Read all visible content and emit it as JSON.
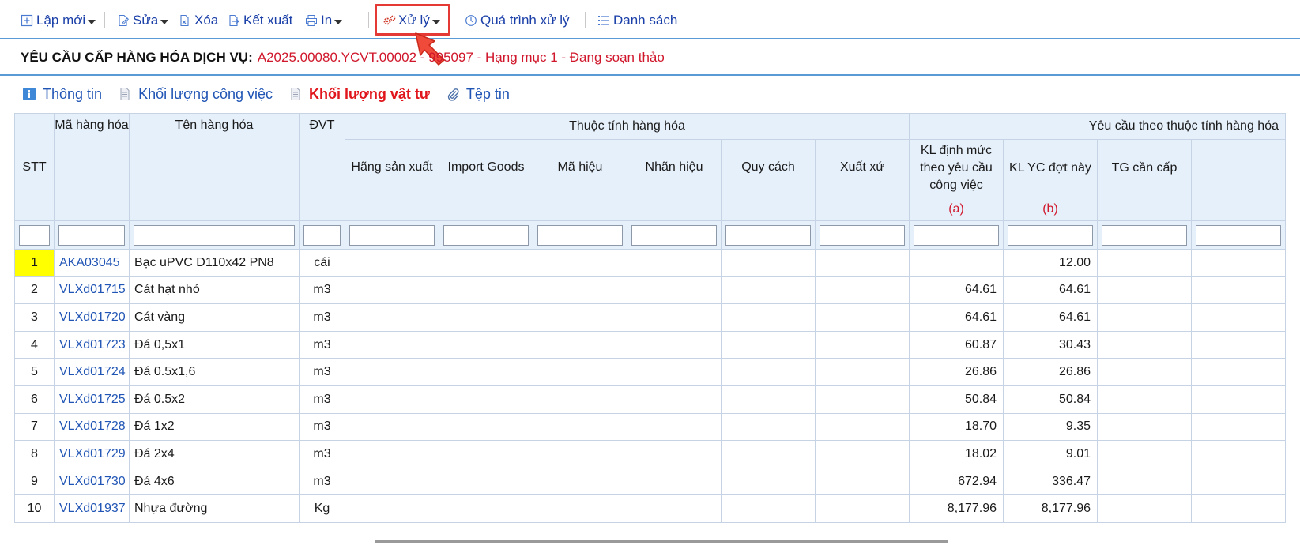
{
  "toolbar": {
    "new_label": "Lập mới",
    "edit_label": "Sửa",
    "delete_label": "Xóa",
    "export_label": "Kết xuất",
    "print_label": "In",
    "process_label": "Xử lý",
    "history_label": "Quá trình xử lý",
    "list_label": "Danh sách"
  },
  "title": {
    "label": "YÊU CẦU CẤP HÀNG HÓA DỊCH VỤ:",
    "value": "A2025.00080.YCVT.00002 - 995097 - Hạng mục 1 - Đang soạn thảo"
  },
  "tabs": [
    {
      "label": "Thông tin",
      "icon": "info-icon"
    },
    {
      "label": "Khối lượng công việc",
      "icon": "document-icon"
    },
    {
      "label": "Khối lượng vật tư",
      "icon": "document-icon"
    },
    {
      "label": "Tệp tin",
      "icon": "paperclip-icon"
    }
  ],
  "table": {
    "headers": {
      "stt": "STT",
      "code": "Mã hàng hóa",
      "name": "Tên hàng hóa",
      "unit": "ĐVT",
      "attr_group": "Thuộc tính hàng hóa",
      "req_group": "Yêu cầu theo thuộc tính hàng hóa",
      "manufacturer": "Hãng sản xuất",
      "import_goods": "Import Goods",
      "model": "Mã hiệu",
      "brand": "Nhãn hiệu",
      "spec": "Quy cách",
      "origin": "Xuất xứ",
      "kl_norm": "KL định mức theo yêu cầu công việc",
      "kl_req": "KL YC đợt này",
      "tg": "TG cần cấp",
      "note_a": "(a)",
      "note_b": "(b)"
    },
    "rows": [
      {
        "stt": "1",
        "code": "AKA03045",
        "name": "Bạc uPVC D110x42 PN8",
        "unit": "cái",
        "kl_norm": "",
        "kl_req": "12.00"
      },
      {
        "stt": "2",
        "code": "VLXd01715",
        "name": "Cát hạt nhỏ",
        "unit": "m3",
        "kl_norm": "64.61",
        "kl_req": "64.61"
      },
      {
        "stt": "3",
        "code": "VLXd01720",
        "name": "Cát vàng",
        "unit": "m3",
        "kl_norm": "64.61",
        "kl_req": "64.61"
      },
      {
        "stt": "4",
        "code": "VLXd01723",
        "name": "Đá 0,5x1",
        "unit": "m3",
        "kl_norm": "60.87",
        "kl_req": "30.43"
      },
      {
        "stt": "5",
        "code": "VLXd01724",
        "name": "Đá 0.5x1,6",
        "unit": "m3",
        "kl_norm": "26.86",
        "kl_req": "26.86"
      },
      {
        "stt": "6",
        "code": "VLXd01725",
        "name": "Đá 0.5x2",
        "unit": "m3",
        "kl_norm": "50.84",
        "kl_req": "50.84"
      },
      {
        "stt": "7",
        "code": "VLXd01728",
        "name": "Đá 1x2",
        "unit": "m3",
        "kl_norm": "18.70",
        "kl_req": "9.35"
      },
      {
        "stt": "8",
        "code": "VLXd01729",
        "name": "Đá 2x4",
        "unit": "m3",
        "kl_norm": "18.02",
        "kl_req": "9.01"
      },
      {
        "stt": "9",
        "code": "VLXd01730",
        "name": "Đá 4x6",
        "unit": "m3",
        "kl_norm": "672.94",
        "kl_req": "336.47"
      },
      {
        "stt": "10",
        "code": "VLXd01937",
        "name": "Nhựa đường",
        "unit": "Kg",
        "kl_norm": "8,177.96",
        "kl_req": "8,177.96"
      }
    ]
  }
}
